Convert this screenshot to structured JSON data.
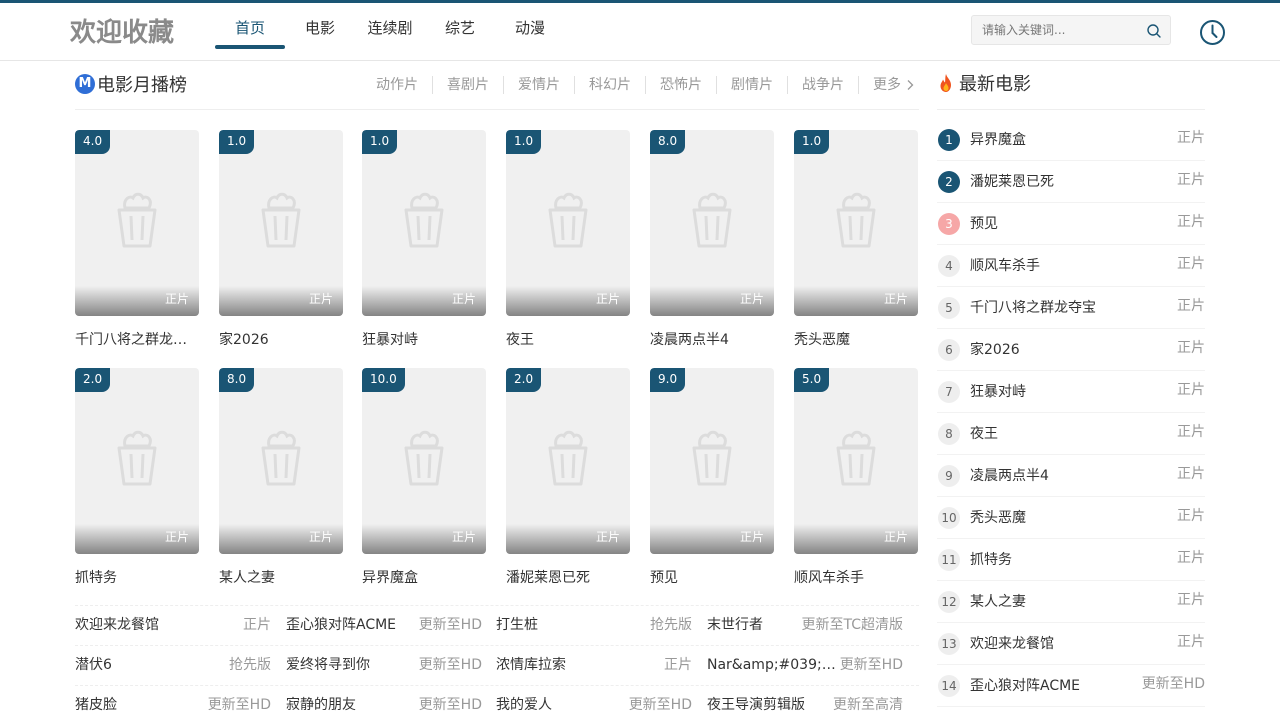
{
  "header": {
    "logo": "欢迎收藏",
    "nav": [
      "首页",
      "电影",
      "连续剧",
      "综艺",
      "动漫"
    ],
    "active_nav": 0,
    "search_placeholder": "请输入关键词..."
  },
  "section": {
    "badge": "M",
    "title": "电影月播榜",
    "categories": [
      "动作片",
      "喜剧片",
      "爱情片",
      "科幻片",
      "恐怖片",
      "剧情片",
      "战争片",
      "更多"
    ]
  },
  "cards": [
    {
      "score": "4.0",
      "status": "正片",
      "title": "千门八将之群龙夺宝"
    },
    {
      "score": "1.0",
      "status": "正片",
      "title": "家2026"
    },
    {
      "score": "1.0",
      "status": "正片",
      "title": "狂暴对峙"
    },
    {
      "score": "1.0",
      "status": "正片",
      "title": "夜王"
    },
    {
      "score": "8.0",
      "status": "正片",
      "title": "凌晨两点半4"
    },
    {
      "score": "1.0",
      "status": "正片",
      "title": "秃头恶魔"
    },
    {
      "score": "2.0",
      "status": "正片",
      "title": "抓特务"
    },
    {
      "score": "8.0",
      "status": "正片",
      "title": "某人之妻"
    },
    {
      "score": "10.0",
      "status": "正片",
      "title": "异界魔盒"
    },
    {
      "score": "2.0",
      "status": "正片",
      "title": "潘妮莱恩已死"
    },
    {
      "score": "9.0",
      "status": "正片",
      "title": "预见"
    },
    {
      "score": "5.0",
      "status": "正片",
      "title": "顺风车杀手"
    }
  ],
  "list": [
    [
      {
        "name": "欢迎来龙餐馆",
        "status": "正片"
      },
      {
        "name": "歪心狼对阵ACME",
        "status": "更新至HD"
      },
      {
        "name": "打生桩",
        "status": "抢先版"
      },
      {
        "name": "末世行者",
        "status": "更新至TC超清版"
      }
    ],
    [
      {
        "name": "潜伏6",
        "status": "抢先版"
      },
      {
        "name": "爱终将寻到你",
        "status": "更新至HD"
      },
      {
        "name": "浓情库拉索",
        "status": "正片"
      },
      {
        "name": "Nar&amp;#039;sat…",
        "status": "更新至HD"
      }
    ],
    [
      {
        "name": "猪皮脸",
        "status": "更新至HD"
      },
      {
        "name": "寂静的朋友",
        "status": "更新至HD"
      },
      {
        "name": "我的爱人",
        "status": "更新至HD"
      },
      {
        "name": "夜王导演剪辑版",
        "status": "更新至高清"
      }
    ]
  ],
  "side": {
    "title": "最新电影",
    "items": [
      {
        "rank": "1",
        "name": "异界魔盒",
        "status": "正片"
      },
      {
        "rank": "2",
        "name": "潘妮莱恩已死",
        "status": "正片"
      },
      {
        "rank": "3",
        "name": "预见",
        "status": "正片"
      },
      {
        "rank": "4",
        "name": "顺风车杀手",
        "status": "正片"
      },
      {
        "rank": "5",
        "name": "千门八将之群龙夺宝",
        "status": "正片"
      },
      {
        "rank": "6",
        "name": "家2026",
        "status": "正片"
      },
      {
        "rank": "7",
        "name": "狂暴对峙",
        "status": "正片"
      },
      {
        "rank": "8",
        "name": "夜王",
        "status": "正片"
      },
      {
        "rank": "9",
        "name": "凌晨两点半4",
        "status": "正片"
      },
      {
        "rank": "10",
        "name": "秃头恶魔",
        "status": "正片"
      },
      {
        "rank": "11",
        "name": "抓特务",
        "status": "正片"
      },
      {
        "rank": "12",
        "name": "某人之妻",
        "status": "正片"
      },
      {
        "rank": "13",
        "name": "欢迎来龙餐馆",
        "status": "正片"
      },
      {
        "rank": "14",
        "name": "歪心狼对阵ACME",
        "status": "更新至HD"
      }
    ]
  },
  "colors": {
    "brand": "#1a5574",
    "third_rank": "#f6a7a7",
    "badge": "#2f6ed6"
  }
}
